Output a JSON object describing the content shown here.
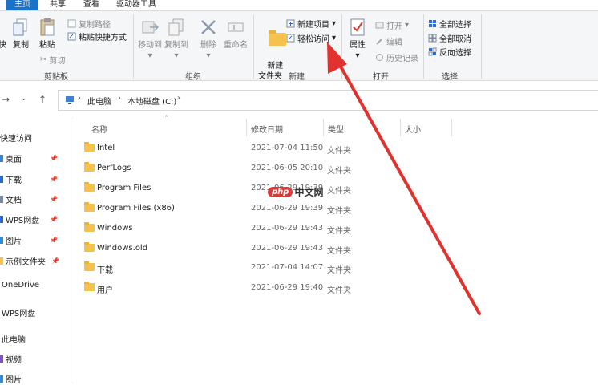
{
  "tabs": [
    {
      "label": "主页",
      "active": true
    },
    {
      "label": "共享",
      "active": false
    },
    {
      "label": "查看",
      "active": false
    },
    {
      "label": "驱动器工具",
      "active": false
    }
  ],
  "ribbon": {
    "clipboard": {
      "pin_label": "快",
      "copy_label": "复制",
      "paste_label": "粘贴",
      "copy_path_label": "复制路径",
      "paste_shortcut_label": "粘贴快捷方式",
      "cut_label": "剪切",
      "group_label": "剪贴板"
    },
    "organize": {
      "move_to_label": "移动到",
      "copy_to_label": "复制到",
      "delete_label": "删除",
      "rename_label": "重命名",
      "group_label": "组织"
    },
    "new": {
      "new_folder_label": "新建\n文件夹",
      "new_item_label": "新建项目",
      "easy_access_label": "轻松访问",
      "group_label": "新建"
    },
    "open": {
      "properties_label": "属性",
      "open_label": "打开",
      "edit_label": "编辑",
      "history_label": "历史记录",
      "group_label": "打开"
    },
    "select": {
      "select_all_label": "全部选择",
      "select_none_label": "全部取消",
      "invert_label": "反向选择",
      "group_label": "选择"
    }
  },
  "address": {
    "crumbs": [
      "此电脑",
      "本地磁盘 (C:)"
    ]
  },
  "nav_pane": {
    "quick_access": "快速访问",
    "items": [
      {
        "label": "桌面",
        "pinned": true
      },
      {
        "label": "下载",
        "pinned": true
      },
      {
        "label": "文档",
        "pinned": true
      },
      {
        "label": "WPS网盘",
        "pinned": true
      },
      {
        "label": "图片",
        "pinned": true
      },
      {
        "label": "示例文件夹",
        "pinned": true
      }
    ],
    "onedrive": "OneDrive",
    "wps": "WPS网盘",
    "this_pc": "此电脑",
    "pc_items": [
      "视频",
      "图片"
    ]
  },
  "columns": {
    "name": "名称",
    "date": "修改日期",
    "type": "类型",
    "size": "大小"
  },
  "files": [
    {
      "name": "Intel",
      "date": "2021-07-04 11:50",
      "type": "文件夹"
    },
    {
      "name": "PerfLogs",
      "date": "2021-06-05 20:10",
      "type": "文件夹"
    },
    {
      "name": "Program Files",
      "date": "2021-06-29 19:39",
      "type": "文件夹"
    },
    {
      "name": "Program Files (x86)",
      "date": "2021-06-29 19:39",
      "type": "文件夹"
    },
    {
      "name": "Windows",
      "date": "2021-06-29 19:43",
      "type": "文件夹"
    },
    {
      "name": "Windows.old",
      "date": "2021-06-29 19:43",
      "type": "文件夹"
    },
    {
      "name": "下载",
      "date": "2021-07-04 14:07",
      "type": "文件夹"
    },
    {
      "name": "用户",
      "date": "2021-06-29 19:40",
      "type": "文件夹"
    }
  ],
  "watermark": {
    "logo": "php",
    "text": "中文网"
  },
  "colors": {
    "accent": "#1a73c7",
    "arrow": "#e0322f",
    "folder": "#f4c24d"
  }
}
